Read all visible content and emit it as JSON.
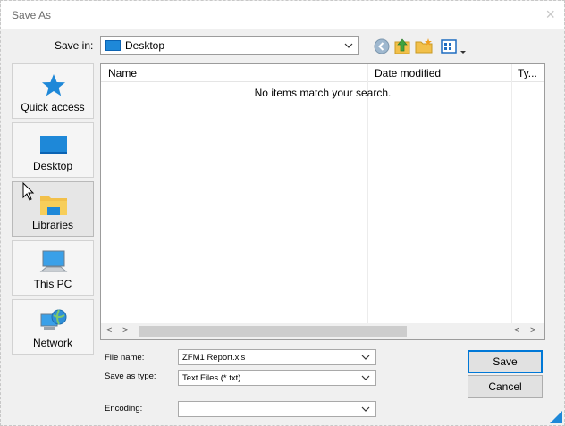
{
  "window": {
    "title": "Save As",
    "close_glyph": "×"
  },
  "save_in": {
    "label": "Save in:",
    "value": "Desktop"
  },
  "toolbar": {
    "back_icon": "back-icon",
    "up_icon": "up-folder-icon",
    "new_folder_icon": "new-folder-icon",
    "view_menu_icon": "view-menu-icon"
  },
  "places": [
    {
      "label": "Quick access",
      "icon": "star-icon"
    },
    {
      "label": "Desktop",
      "icon": "desktop-icon"
    },
    {
      "label": "Libraries",
      "icon": "libraries-icon"
    },
    {
      "label": "This PC",
      "icon": "computer-icon"
    },
    {
      "label": "Network",
      "icon": "network-icon"
    }
  ],
  "list": {
    "columns": [
      "Name",
      "Date modified",
      "Ty..."
    ],
    "empty_message": "No items match your search."
  },
  "form": {
    "file_name_label": "File name:",
    "file_name_value": "ZFM1 Report.xls",
    "save_type_label": "Save as type:",
    "save_type_value": "Text Files (*.txt)",
    "encoding_label": "Encoding:",
    "encoding_value": ""
  },
  "buttons": {
    "save": "Save",
    "cancel": "Cancel"
  },
  "colors": {
    "accent": "#0078d7",
    "folder": "#f2c04a",
    "desktop": "#1e88d8"
  }
}
